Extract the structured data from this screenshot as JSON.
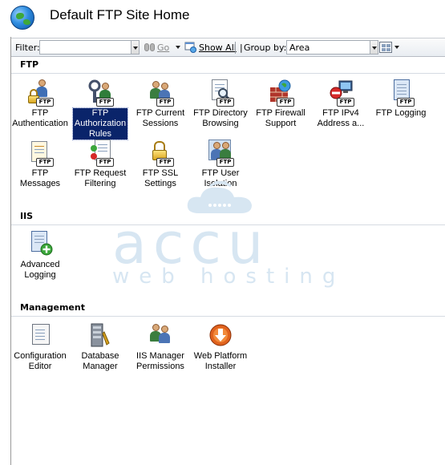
{
  "header": {
    "title": "Default FTP Site Home",
    "icon": "globe-icon"
  },
  "toolbar": {
    "filter_label": "Filter:",
    "filter_value": "",
    "go_label": "Go",
    "show_all_label": "Show All",
    "group_by_label": "Group by:",
    "group_by_value": "Area"
  },
  "sections": {
    "ftp": {
      "title": "FTP",
      "items": [
        {
          "label": "FTP\nAuthentication",
          "icon": "lock-users-icon"
        },
        {
          "label": "FTP\nAuthorization\nRules",
          "icon": "key-users-icon",
          "selected": true
        },
        {
          "label": "FTP Current\nSessions",
          "icon": "users-icon"
        },
        {
          "label": "FTP Directory\nBrowsing",
          "icon": "document-magnifier-icon"
        },
        {
          "label": "FTP Firewall\nSupport",
          "icon": "firewall-icon"
        },
        {
          "label": "FTP IPv4\nAddress a...",
          "icon": "computer-deny-icon"
        },
        {
          "label": "FTP Logging",
          "icon": "notebook-icon"
        },
        {
          "label": "FTP Messages",
          "icon": "message-document-icon"
        },
        {
          "label": "FTP Request\nFiltering",
          "icon": "filter-list-icon"
        },
        {
          "label": "FTP SSL\nSettings",
          "icon": "ssl-lock-icon"
        },
        {
          "label": "FTP User\nIsolation",
          "icon": "user-isolation-icon"
        }
      ]
    },
    "iis": {
      "title": "IIS",
      "items": [
        {
          "label": "Advanced\nLogging",
          "icon": "advanced-logging-icon"
        }
      ]
    },
    "management": {
      "title": "Management",
      "items": [
        {
          "label": "Configuration\nEditor",
          "icon": "configuration-editor-icon"
        },
        {
          "label": "Database\nManager",
          "icon": "database-manager-icon"
        },
        {
          "label": "IIS Manager\nPermissions",
          "icon": "permissions-icon"
        },
        {
          "label": "Web Platform\nInstaller",
          "icon": "web-platform-installer-icon"
        }
      ]
    }
  },
  "badge_text": "FTP",
  "watermark": {
    "main": "accu",
    "sub": "web hosting"
  },
  "colors": {
    "selection": "#0a246a",
    "watermark": "#d7e6f2"
  }
}
